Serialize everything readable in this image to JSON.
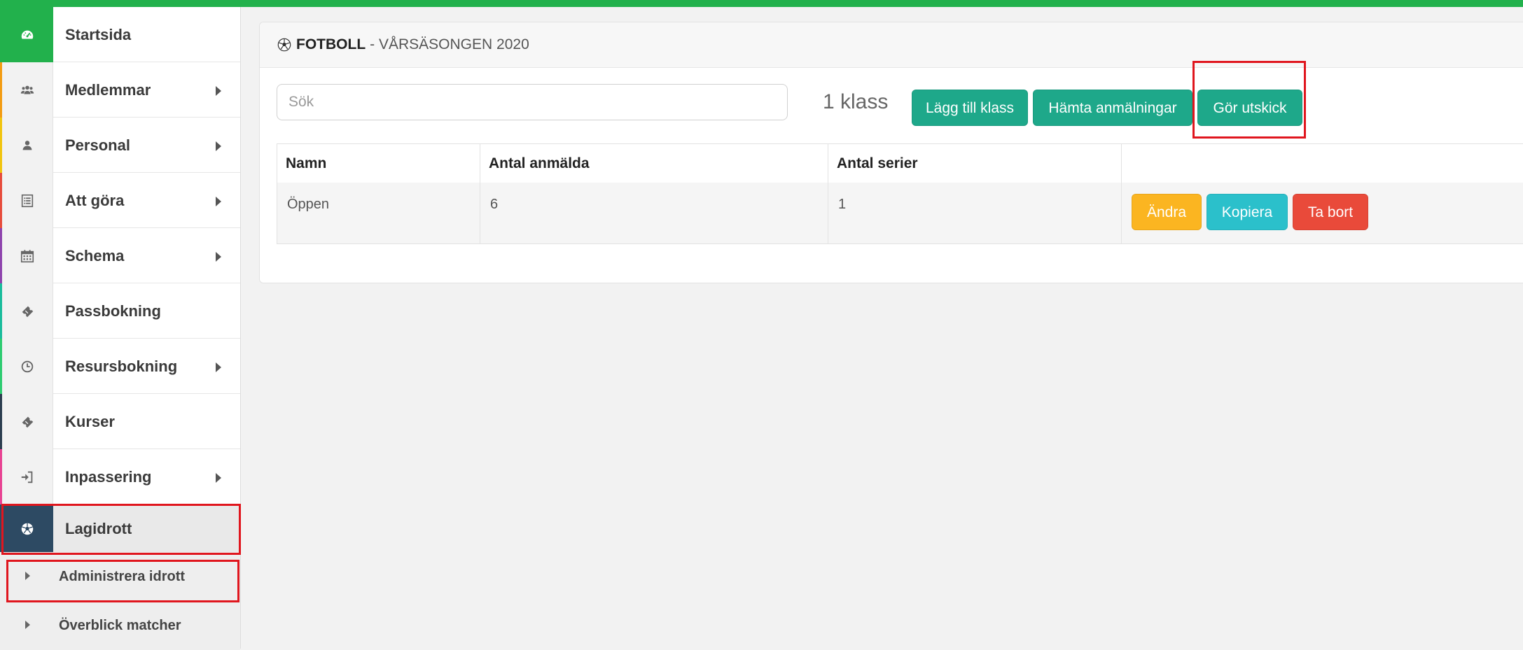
{
  "sidebar": {
    "items": [
      {
        "label": "Startsida",
        "icon": "dashboard-icon",
        "stripe": "#22b14c",
        "has_caret": false
      },
      {
        "label": "Medlemmar",
        "icon": "users-icon",
        "stripe": "#f39c12",
        "has_caret": true
      },
      {
        "label": "Personal",
        "icon": "user-icon",
        "stripe": "#f1c40f",
        "has_caret": true
      },
      {
        "label": "Att göra",
        "icon": "list-icon",
        "stripe": "#e74c3c",
        "has_caret": true
      },
      {
        "label": "Schema",
        "icon": "calendar-icon",
        "stripe": "#8e44ad",
        "has_caret": true
      },
      {
        "label": "Passbokning",
        "icon": "ticket-icon",
        "stripe": "#1abc9c",
        "has_caret": false
      },
      {
        "label": "Resursbokning",
        "icon": "clock-icon",
        "stripe": "#2ecc71",
        "has_caret": true
      },
      {
        "label": "Kurser",
        "icon": "ticket-icon",
        "stripe": "#2c3e50",
        "has_caret": false
      },
      {
        "label": "Inpassering",
        "icon": "sign-in-icon",
        "stripe": "#e84393",
        "has_caret": true
      },
      {
        "label": "Lagidrott",
        "icon": "soccer-ball-icon",
        "stripe": "#2d4a63",
        "has_caret": false
      }
    ],
    "sub_items": [
      {
        "label": "Administrera idrott"
      },
      {
        "label": "Överblick matcher"
      }
    ]
  },
  "panel": {
    "title_sport": "FOTBOLL",
    "title_season": "- VÅRSÄSONGEN 2020",
    "search_placeholder": "Sök",
    "class_count": "1 klass",
    "buttons": {
      "add_class": "Lägg till klass",
      "fetch_registrations": "Hämta anmälningar",
      "send_out": "Gör utskick"
    }
  },
  "table": {
    "headers": [
      "Namn",
      "Antal anmälda",
      "Antal serier",
      ""
    ],
    "rows": [
      {
        "name": "Öppen",
        "registered": "6",
        "series": "1"
      }
    ],
    "row_actions": {
      "edit": "Ändra",
      "copy": "Kopiera",
      "delete": "Ta bort"
    }
  },
  "colors": {
    "accent_green": "#22b14c",
    "button_green": "#1ea88a",
    "button_orange": "#fbb521",
    "button_cyan": "#2bc0cb",
    "button_red": "#e94a3a",
    "highlight_red": "#e0161e",
    "active_dark": "#2d4a63"
  }
}
